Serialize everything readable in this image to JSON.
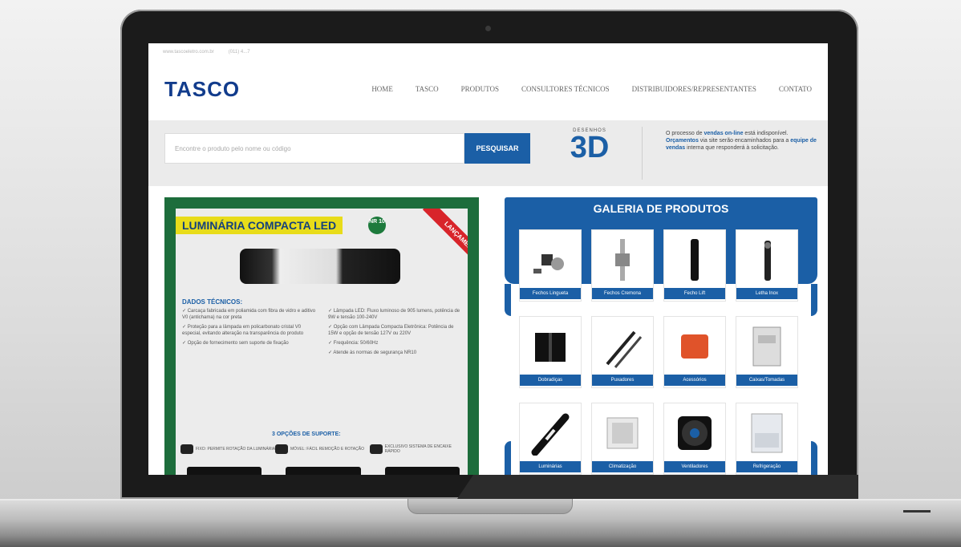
{
  "topbar": {
    "email": "www.tascoeletro.com.br",
    "phone": "(011) 4...7"
  },
  "header": {
    "logo": "TASCO",
    "nav": [
      "HOME",
      "TASCO",
      "PRODUTOS",
      "CONSULTORES TÉCNICOS",
      "DISTRIBUIDORES/REPRESENTANTES",
      "CONTATO"
    ]
  },
  "search": {
    "placeholder": "Encontre o produto pelo nome ou código",
    "button": "PESQUISAR",
    "badge_small": "DESENHOS",
    "badge_big": "3D"
  },
  "notice": {
    "p1": "O processo de ",
    "link1": "vendas on-line",
    "p2": " está indisponível. ",
    "link2": "Orçamentos",
    "p3": " via site serão encaminhados para a ",
    "link3": "equipe de vendas",
    "p4": " interna que responderá à solicitação."
  },
  "promo": {
    "title": "LUMINÁRIA COMPACTA LED",
    "nr_badge": "NR 10",
    "ribbon": "LANÇAMENTO",
    "dados_title": "DADOS TÉCNICOS:",
    "specs": [
      "✓ Carcaça fabricada em poliamida com fibra de vidro e aditivo V0 (antichama) na cor preta",
      "✓ Proteção para a lâmpada em policarbonato cristal V0 especial, evitando alteração na transparência do produto",
      "✓ Opção de fornecimento sem suporte de fixação",
      "✓ Lâmpada LED: Fluxo luminoso de 905 lumens, potência de 9W e tensão 100-240V",
      "✓ Opção com Lâmpada Compacta Eletrônica: Potência de 15W e opção de tensão 127V ou 220V",
      "✓ Frequência: 50/60Hz",
      "✓ Atende às normas de segurança NR10"
    ],
    "opcoes_title": "3 OPÇÕES DE SUPORTE:",
    "supports": [
      "FIXO: PERMITE ROTAÇÃO DA LUMINÁRIA",
      "MÓVEL: FÁCIL REMOÇÃO E ROTAÇÃO",
      "EXCLUSIVO SISTEMA DE ENCAIXE RÁPIDO"
    ]
  },
  "gallery": {
    "title": "GALERIA DE PRODUTOS",
    "items": [
      {
        "label": "Fechos Lingueta",
        "icon": "latch-icon"
      },
      {
        "label": "Fechos Cremona",
        "icon": "cremona-icon"
      },
      {
        "label": "Fecho Lift",
        "icon": "lift-lock-icon"
      },
      {
        "label": "Letha Inox",
        "icon": "handle-icon"
      },
      {
        "label": "Dobradiças",
        "icon": "hinge-icon"
      },
      {
        "label": "Puxadores",
        "icon": "pull-handle-icon"
      },
      {
        "label": "Acessórios",
        "icon": "accessory-icon"
      },
      {
        "label": "Caixas/Tomadas",
        "icon": "socket-box-icon"
      },
      {
        "label": "Luminárias",
        "icon": "lamp-icon"
      },
      {
        "label": "Climatização",
        "icon": "vent-icon"
      },
      {
        "label": "Ventiladores",
        "icon": "fan-icon"
      },
      {
        "label": "Refrigeração",
        "icon": "cooling-unit-icon"
      }
    ]
  }
}
